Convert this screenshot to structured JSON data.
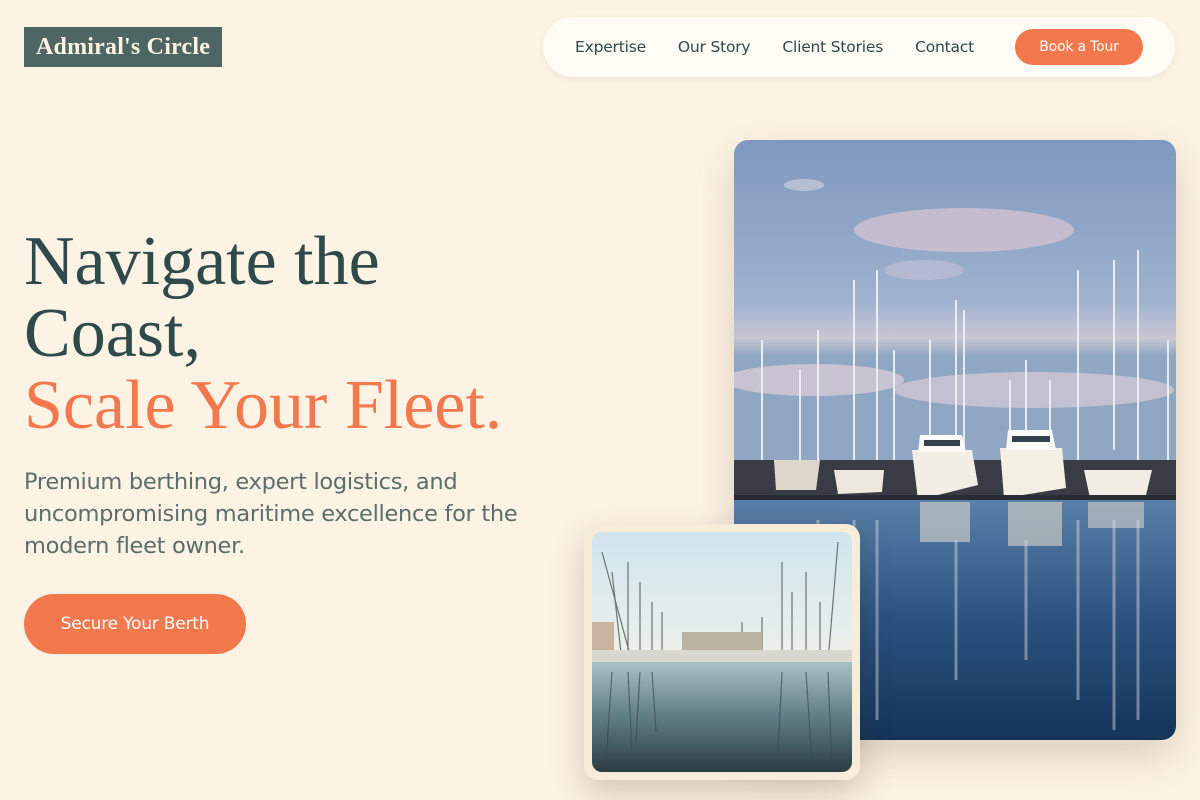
{
  "brand": {
    "name": "Admiral's Circle"
  },
  "nav": {
    "links": [
      "Expertise",
      "Our Story",
      "Client Stories",
      "Contact"
    ],
    "cta": "Book a Tour"
  },
  "hero": {
    "headline_line1": "Navigate the",
    "headline_line2": "Coast,",
    "headline_accent": "Scale Your Fleet.",
    "subtext": "Premium berthing, expert logistics, and uncompromising maritime excellence for the modern fleet owner.",
    "cta": "Secure Your Berth"
  },
  "images": {
    "main": "marina-yachts-photo",
    "secondary": "sailboat-harbor-photo"
  },
  "colors": {
    "background": "#fdf3e4",
    "primary": "#2f4a4a",
    "accent": "#f4784d",
    "logo_bg": "#4d6663"
  }
}
